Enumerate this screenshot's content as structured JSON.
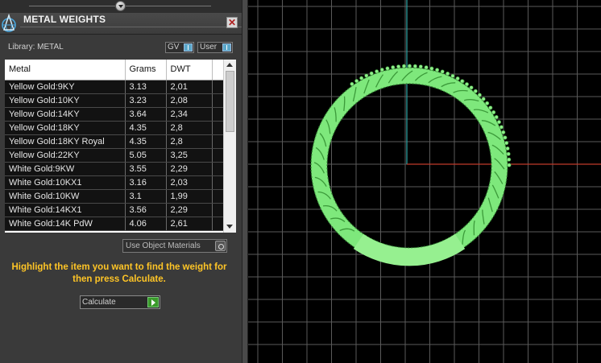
{
  "panel": {
    "title": "METAL WEIGHTS",
    "close_symbol": "✕",
    "library_label": "Library: METAL",
    "gv_label": "GV",
    "user_label": "User"
  },
  "table": {
    "headers": [
      "Metal",
      "Grams",
      "DWT"
    ],
    "rows": [
      [
        "Yellow Gold:9KY",
        "3.13",
        "2,01"
      ],
      [
        "Yellow Gold:10KY",
        "3.23",
        "2,08"
      ],
      [
        "Yellow Gold:14KY",
        "3.64",
        "2,34"
      ],
      [
        "Yellow Gold:18KY",
        "4.35",
        "2,8"
      ],
      [
        "Yellow Gold:18KY Royal",
        "4.35",
        "2,8"
      ],
      [
        "Yellow Gold:22KY",
        "5.05",
        "3,25"
      ],
      [
        "White Gold:9KW",
        "3.55",
        "2,29"
      ],
      [
        "White Gold:10KX1",
        "3.16",
        "2,03"
      ],
      [
        "White Gold:10KW",
        "3.1",
        "1,99"
      ],
      [
        "White Gold:14KX1",
        "3.56",
        "2,29"
      ],
      [
        "White Gold:14K PdW",
        "4.06",
        "2,61"
      ]
    ]
  },
  "use_object_materials_label": "Use Object Materials",
  "instructions": "Highlight the item you want to find the weight for then press Calculate.",
  "calculate_label": "Calculate",
  "colors": {
    "ring": "#7ee87c",
    "x_axis": "#c0392b",
    "y_axis": "#2a9a9a",
    "grid": "#5a5a5a",
    "instructions": "#ffc526"
  },
  "icons": {
    "logo": "app-logo-icon",
    "close": "close-icon",
    "calculate": "play-arrow-icon",
    "use_object": "radio-icon",
    "collapse": "collapse-knob-icon"
  }
}
